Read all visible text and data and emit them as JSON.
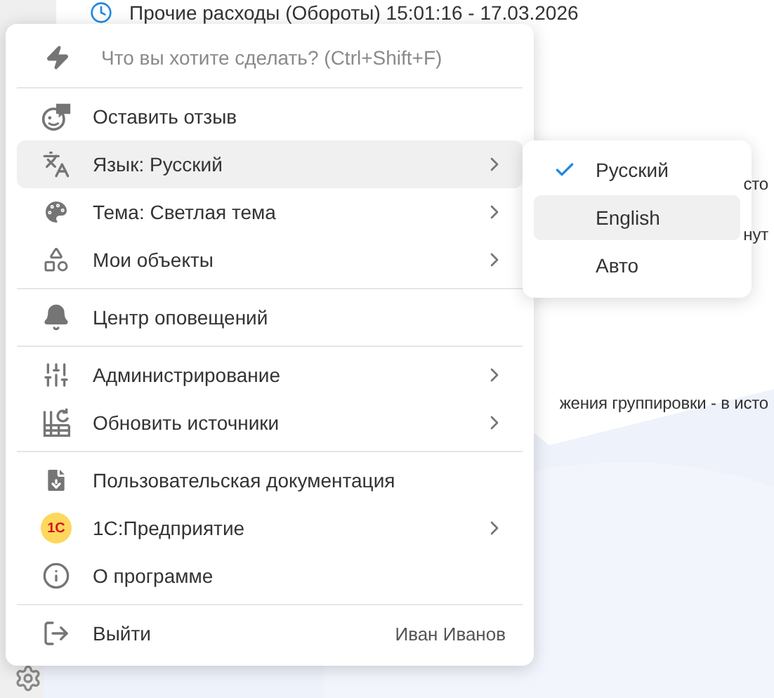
{
  "background": {
    "header_line": "Прочие расходы (Обороты) 15:01:16 - 17.03.2026",
    "fragments": [
      "сто",
      "нут",
      "жения группировки - в исто"
    ]
  },
  "menu": {
    "search": {
      "placeholder": "Что вы хотите сделать? (Ctrl+Shift+F)"
    },
    "sections": [
      [
        {
          "label": "Оставить отзыв",
          "submenu": false,
          "selected": false
        },
        {
          "label": "Язык: Русский",
          "submenu": true,
          "selected": true
        },
        {
          "label": "Тема: Светлая тема",
          "submenu": true,
          "selected": false
        },
        {
          "label": "Мои объекты",
          "submenu": true,
          "selected": false
        }
      ],
      [
        {
          "label": "Центр оповещений",
          "submenu": false,
          "selected": false
        }
      ],
      [
        {
          "label": "Администрирование",
          "submenu": true,
          "selected": false
        },
        {
          "label": "Обновить источники",
          "submenu": true,
          "selected": false
        }
      ],
      [
        {
          "label": "Пользовательская документация",
          "submenu": false,
          "selected": false
        },
        {
          "label": "1С:Предприятие",
          "submenu": true,
          "selected": false,
          "logo": "1С"
        },
        {
          "label": "О программе",
          "submenu": false,
          "selected": false
        }
      ],
      [
        {
          "label": "Выйти",
          "submenu": false,
          "selected": false,
          "user": "Иван Иванов"
        }
      ]
    ]
  },
  "language_menu": [
    {
      "label": "Русский",
      "checked": true,
      "selected": false
    },
    {
      "label": "English",
      "checked": false,
      "selected": true
    },
    {
      "label": "Авто",
      "checked": false,
      "selected": false
    }
  ]
}
